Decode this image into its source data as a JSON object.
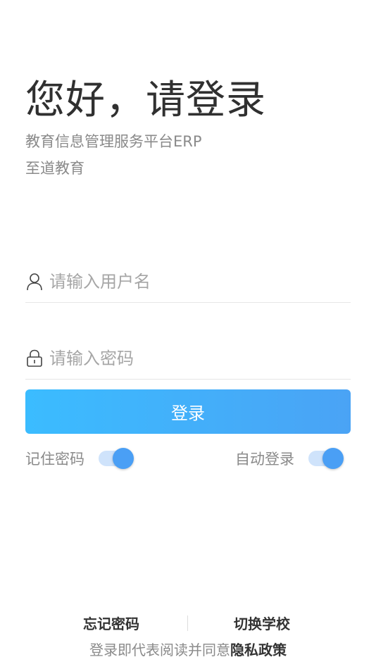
{
  "header": {
    "greeting": "您好，请登录",
    "subtitle": "教育信息管理服务平台ERP",
    "org_name": "至道教育"
  },
  "form": {
    "username_placeholder": "请输入用户名",
    "password_placeholder": "请输入密码",
    "login_button": "登录"
  },
  "options": {
    "remember_label": "记住密码",
    "remember_on": true,
    "auto_login_label": "自动登录",
    "auto_login_on": true
  },
  "footer": {
    "forgot_password": "忘记密码",
    "switch_school": "切换学校",
    "agreement_prefix": "登录即代表阅读并同意",
    "privacy_policy": "隐私政策"
  },
  "colors": {
    "accent": "#4a9ff5",
    "button_gradient_start": "#3bbcff",
    "button_gradient_end": "#4aa3f5",
    "toggle_track": "#cfe3fb"
  }
}
